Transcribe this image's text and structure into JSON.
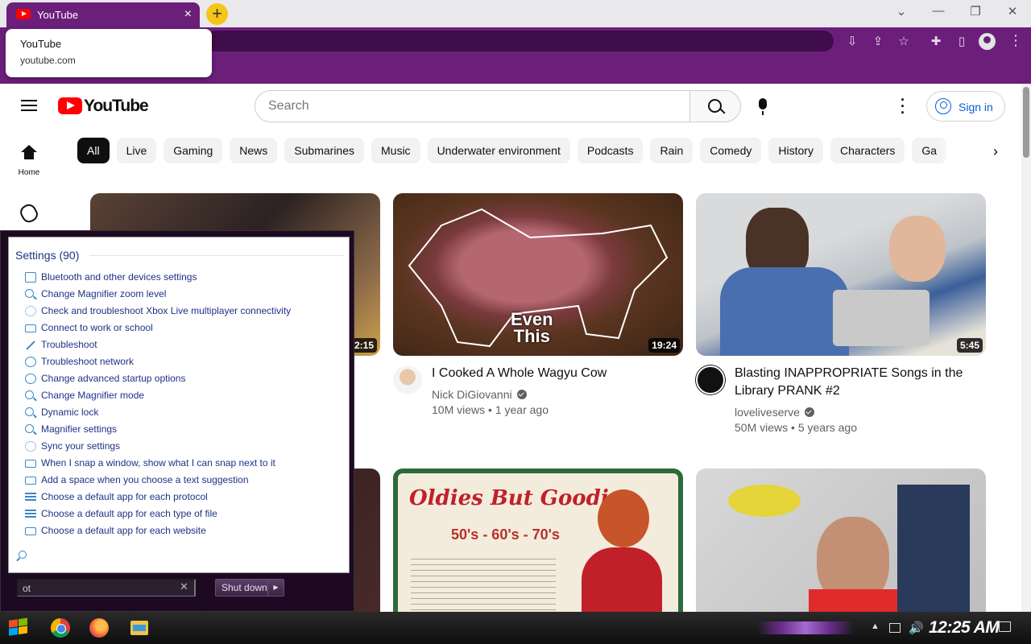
{
  "browser": {
    "tab": {
      "title": "YouTube"
    },
    "tooltip": {
      "title": "YouTube",
      "url": "youtube.com"
    }
  },
  "youtube": {
    "logo_text": "YouTube",
    "search": {
      "placeholder": "Search"
    },
    "sign_in_label": "Sign in",
    "nav": {
      "home_label": "Home"
    },
    "chips": [
      "All",
      "Live",
      "Gaming",
      "News",
      "Submarines",
      "Music",
      "Underwater environment",
      "Podcasts",
      "Rain",
      "Comedy",
      "History",
      "Characters",
      "Ga"
    ],
    "videos": [
      {
        "duration": "2:15"
      },
      {
        "duration": "19:24",
        "overlay_line1": "Even",
        "overlay_line2": "This",
        "title": "I Cooked A Whole Wagyu Cow",
        "channel": "Nick DiGiovanni",
        "views": "10M views",
        "age": "1 year ago"
      },
      {
        "duration": "5:45",
        "title": "Blasting INAPPROPRIATE Songs in the Library PRANK #2",
        "channel": "loveliveserve",
        "views": "50M views",
        "age": "5 years ago"
      }
    ],
    "second_row": {
      "oldies_title": "Oldies But Goodies",
      "oldies_decades": "50's - 60's - 70's"
    }
  },
  "start_menu": {
    "results_header": "Settings (90)",
    "results": [
      {
        "label": "Bluetooth and other devices settings",
        "icon": "devices-icon"
      },
      {
        "label": "Change Magnifier zoom level",
        "icon": "magnifier-icon"
      },
      {
        "label": "Check and troubleshoot Xbox Live multiplayer connectivity",
        "icon": "gear-icon"
      },
      {
        "label": "Connect to work or school",
        "icon": "briefcase-icon"
      },
      {
        "label": "Troubleshoot",
        "icon": "wrench-icon"
      },
      {
        "label": "Troubleshoot network",
        "icon": "globe-icon"
      },
      {
        "label": "Change advanced startup options",
        "icon": "history-icon"
      },
      {
        "label": "Change Magnifier mode",
        "icon": "magnifier-icon"
      },
      {
        "label": "Dynamic lock",
        "icon": "key-icon"
      },
      {
        "label": "Magnifier settings",
        "icon": "magnifier-icon"
      },
      {
        "label": "Sync your settings",
        "icon": "sync-icon"
      },
      {
        "label": "When I snap a window, show what I can snap next to it",
        "icon": "snap-icon"
      },
      {
        "label": "Add a space when you choose a text suggestion",
        "icon": "keyboard-icon"
      },
      {
        "label": "Choose a default app for each protocol",
        "icon": "list-icon"
      },
      {
        "label": "Choose a default app for each type of file",
        "icon": "list-icon"
      },
      {
        "label": "Choose a default app for each website",
        "icon": "window-icon"
      }
    ],
    "search_value": "ot",
    "shutdown_label": "Shut down"
  },
  "taskbar": {
    "clock": "12:25 AM"
  },
  "colors": {
    "browser_purple": "#6b1f7a",
    "youtube_red": "#ff0000",
    "link_blue": "#065fd4"
  }
}
